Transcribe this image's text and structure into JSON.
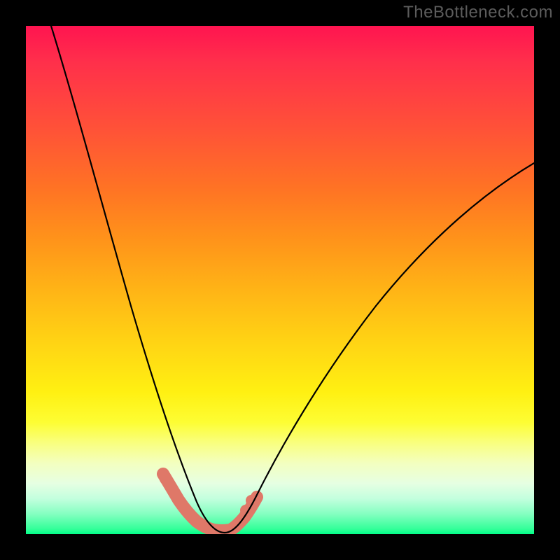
{
  "watermark": "TheBottleneck.com",
  "chart_data": {
    "type": "line",
    "title": "",
    "xlabel": "",
    "ylabel": "",
    "xlim": [
      0,
      100
    ],
    "ylim": [
      0,
      100
    ],
    "grid": false,
    "legend": false,
    "background_gradient": {
      "stops": [
        {
          "pct": 0,
          "color": "#ff1450"
        },
        {
          "pct": 20,
          "color": "#ff5138"
        },
        {
          "pct": 50,
          "color": "#ffb416"
        },
        {
          "pct": 75,
          "color": "#fff012"
        },
        {
          "pct": 90,
          "color": "#e6ffe2"
        },
        {
          "pct": 100,
          "color": "#00ff88"
        }
      ]
    },
    "series": [
      {
        "name": "black-curve",
        "color": "#000000",
        "width": 2,
        "x": [
          5,
          8,
          12,
          16,
          20,
          24,
          28,
          31,
          33,
          35,
          36,
          37,
          38,
          39,
          40,
          42,
          45,
          50,
          60,
          72,
          85,
          100
        ],
        "y": [
          100,
          85,
          70,
          56,
          43,
          31,
          20,
          12,
          7,
          4,
          2.5,
          1.5,
          1,
          1,
          1.2,
          2,
          4,
          10,
          25,
          42,
          57,
          72
        ]
      },
      {
        "name": "salmon-bottom-curve",
        "color": "#e07a6a",
        "width": 9,
        "x": [
          31,
          33,
          35,
          36,
          37,
          38,
          39,
          40,
          42,
          45
        ],
        "y": [
          12,
          7,
          4,
          2.5,
          1.5,
          1,
          1,
          1.2,
          2,
          4
        ]
      }
    ]
  }
}
